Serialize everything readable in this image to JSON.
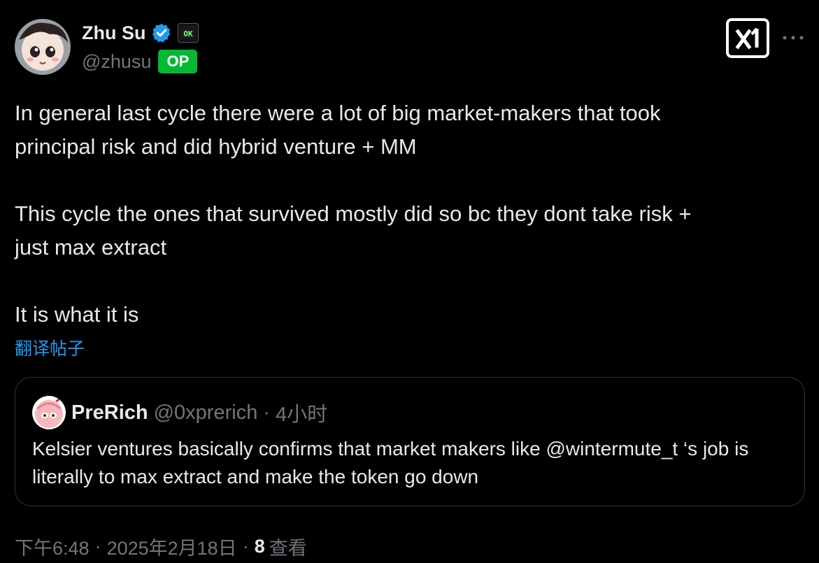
{
  "post": {
    "author": {
      "display_name": "Zhu Su",
      "handle": "@zhusu",
      "verified": true,
      "affiliation_badge": "OK",
      "op_label": "OP"
    },
    "body": [
      "In general last cycle there were a lot of big market-makers that took\nprincipal risk and did hybrid venture + MM",
      "This cycle the ones that survived mostly did so bc they dont take risk +\njust max extract",
      "It is what it is"
    ],
    "translate_label": "翻译帖子",
    "time": "下午6:48",
    "date": "2025年2月18日",
    "separator": "·",
    "views_count": "8",
    "views_label": "查看"
  },
  "quote": {
    "display_name": "PreRich",
    "handle": "@0xprerich",
    "separator": "·",
    "time_ago": "4小时",
    "text": "Kelsier ventures basically confirms that market makers like @wintermute_t ‘s job is literally to max extract and make the token go down"
  },
  "icons": {
    "verified": "verified-badge-icon",
    "affiliation": "terminal-ok-icon",
    "grok": "grok-icon",
    "more": "more-horizontal-icon"
  },
  "colors": {
    "background": "#000000",
    "text_primary": "#e7e9ea",
    "text_secondary": "#71767b",
    "link": "#1d9bf0",
    "verified": "#1d9bf0",
    "op_badge": "#00ba33",
    "border": "#2f3336"
  }
}
